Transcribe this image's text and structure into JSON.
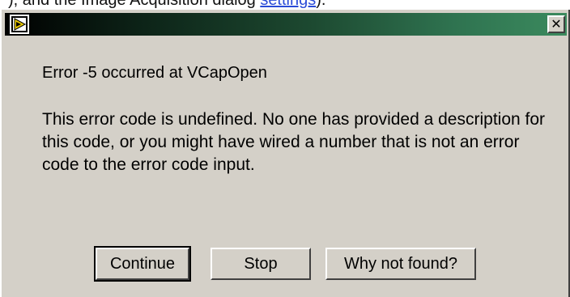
{
  "background_fragment": {
    "text": "), and the Image Acquisition dialog ",
    "link": "settings",
    "suffix": ")."
  },
  "dialog": {
    "title": "",
    "close_glyph": "✕",
    "heading": "Error -5 occurred at VCapOpen",
    "message": "This error code is undefined. No one has provided a description for this code, or you might have wired a number that is not an error code to the error code input.",
    "buttons": {
      "continue": "Continue",
      "stop": "Stop",
      "why_not_found": "Why not found?"
    },
    "default_button": "continue",
    "icon": "labview-run-arrow-icon"
  },
  "colors": {
    "face": "#d4d0c8",
    "titlebar_start": "#000000",
    "titlebar_end": "#3b8a5e",
    "link": "#2a4bd7"
  }
}
